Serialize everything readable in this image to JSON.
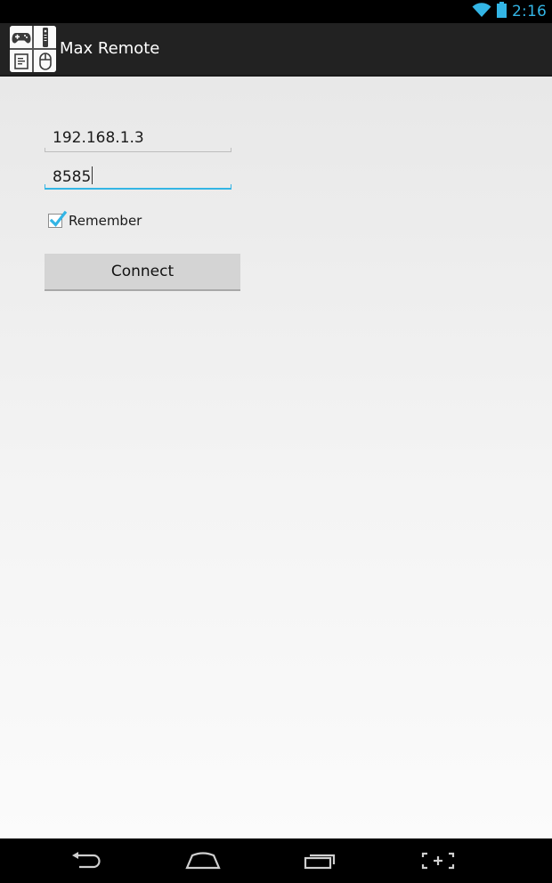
{
  "status_bar": {
    "time": "2:16",
    "wifi_icon": "wifi-icon",
    "battery_icon": "battery-icon",
    "accent_color": "#33b5e5"
  },
  "action_bar": {
    "title": "Max Remote",
    "icon": "max-remote-app-icon"
  },
  "form": {
    "ip_value": "192.168.1.3",
    "port_value": "8585",
    "remember_label": "Remember",
    "remember_checked": true,
    "connect_label": "Connect"
  },
  "nav_bar": {
    "back_icon": "back-icon",
    "home_icon": "home-icon",
    "recents_icon": "recent-apps-icon",
    "screenshot_icon": "screenshot-icon"
  }
}
